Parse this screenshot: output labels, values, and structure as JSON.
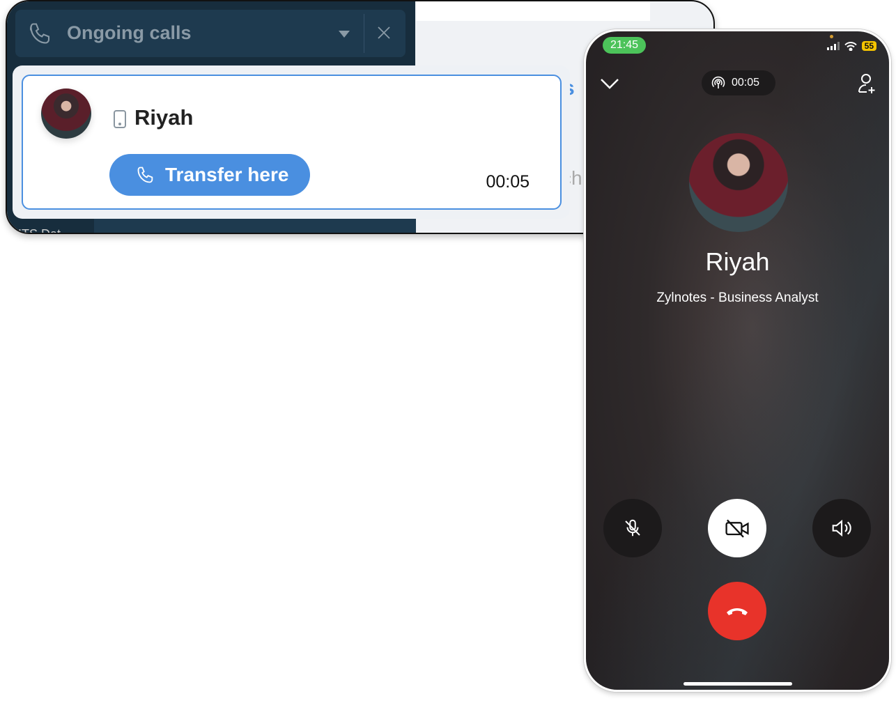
{
  "desktop": {
    "header": {
      "title": "Ongoing calls",
      "icon": "phone-icon",
      "dropdown_icon": "caret-down-icon",
      "close_icon": "close-icon"
    },
    "background_fragments": {
      "s": "s",
      "ch": "ch",
      "below": "ITS Dat"
    },
    "call_card": {
      "name": "Riyah",
      "device_icon": "mobile-icon",
      "transfer_label": "Transfer here",
      "duration": "00:05"
    },
    "accent_color": "#4a8fe0"
  },
  "phone": {
    "status_bar": {
      "time": "21:45",
      "battery": "55"
    },
    "call_timer": "00:05",
    "caller_name": "Riyah",
    "caller_role": "Zylnotes - Business Analyst",
    "controls": [
      "mute",
      "video-off",
      "speaker",
      "end-call"
    ],
    "end_call_color": "#e8332a"
  }
}
